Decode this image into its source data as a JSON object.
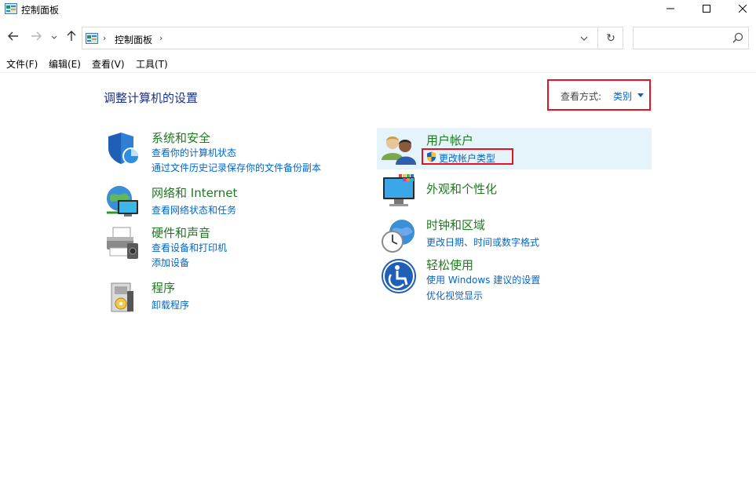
{
  "window": {
    "title": "控制面板",
    "icon": "control-panel-icon",
    "controls": [
      "minimize-icon",
      "maximize-icon",
      "close-icon"
    ]
  },
  "navigation": {
    "back": "arrow-left-icon",
    "forward": "arrow-right-icon",
    "recent": "chevron-down-icon",
    "up": "arrow-up-icon",
    "breadcrumb": [
      "控制面板"
    ],
    "refresh": "↻",
    "search_placeholder": ""
  },
  "menu": {
    "file": "文件(F)",
    "edit": "编辑(E)",
    "view": "查看(V)",
    "tools": "工具(T)"
  },
  "main": {
    "heading": "调整计算机的设置",
    "view_by_label": "查看方式:",
    "view_by_value": "类别"
  },
  "categories": {
    "security": {
      "title": "系统和安全",
      "links": [
        "查看你的计算机状态",
        "通过文件历史记录保存你的文件备份副本"
      ]
    },
    "network": {
      "title": "网络和 Internet",
      "links": [
        "查看网络状态和任务"
      ]
    },
    "hardware": {
      "title": "硬件和声音",
      "links": [
        "查看设备和打印机",
        "添加设备"
      ]
    },
    "programs": {
      "title": "程序",
      "links": [
        "卸载程序"
      ]
    },
    "users": {
      "title": "用户帐户",
      "links": [
        "更改帐户类型"
      ]
    },
    "appearance": {
      "title": "外观和个性化",
      "links": []
    },
    "clock": {
      "title": "时钟和区域",
      "links": [
        "更改日期、时间或数字格式"
      ]
    },
    "ease": {
      "title": "轻松使用",
      "links": [
        "使用 Windows 建议的设置",
        "优化视觉显示"
      ]
    }
  },
  "colors": {
    "link": "#0066cc",
    "category_title": "#1e7a1e",
    "heading": "#1e3287",
    "highlight_box": "#e81123",
    "hover_bg": "#e5f3fb"
  }
}
